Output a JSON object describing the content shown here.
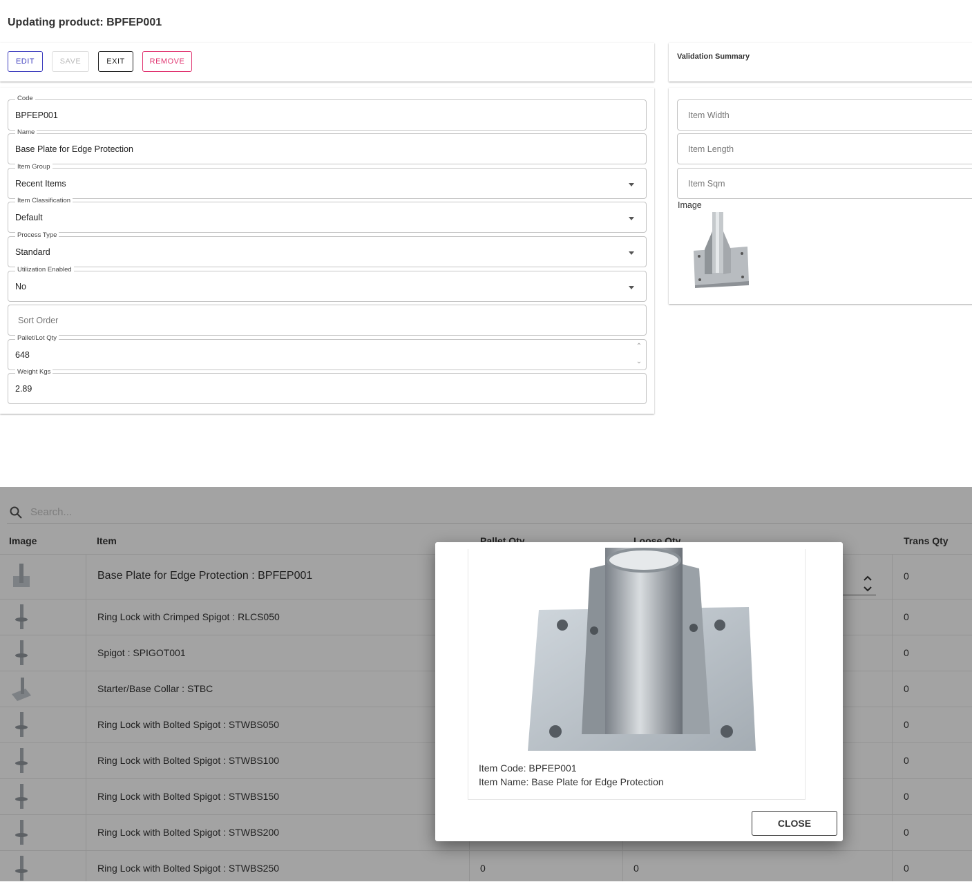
{
  "page": {
    "title": "Updating product: BPFEP001"
  },
  "toolbar": {
    "edit": "EDIT",
    "save": "SAVE",
    "exit": "EXIT",
    "remove": "REMOVE"
  },
  "validation": {
    "title": "Validation Summary"
  },
  "form": {
    "code": {
      "label": "Code",
      "value": "BPFEP001"
    },
    "name": {
      "label": "Name",
      "value": "Base Plate for Edge Protection"
    },
    "item_group": {
      "label": "Item Group",
      "value": "Recent Items"
    },
    "item_classification": {
      "label": "Item Classification",
      "value": "Default"
    },
    "process_type": {
      "label": "Process Type",
      "value": "Standard"
    },
    "utilization_enabled": {
      "label": "Utilization Enabled",
      "value": "No"
    },
    "sort_order": {
      "placeholder": "Sort Order"
    },
    "pallet_lot_qty": {
      "label": "Pallet/Lot Qty",
      "value": "648"
    },
    "weight_kgs": {
      "label": "Weight Kgs",
      "value": "2.89"
    }
  },
  "side": {
    "item_width": "Item Width",
    "item_length": "Item Length",
    "item_sqm": "Item Sqm",
    "image_label": "Image"
  },
  "table": {
    "search_placeholder": "Search...",
    "headers": {
      "image": "Image",
      "item": "Item",
      "pallet_qty": "Pallet Qty",
      "loose_qty": "Loose Qty",
      "trans_qty": "Trans Qty"
    },
    "rows": [
      {
        "item": "Base Plate for Edge Protection : BPFEP001",
        "trans_qty": "0"
      },
      {
        "item": "Ring Lock with Crimped Spigot : RLCS050",
        "trans_qty": "0"
      },
      {
        "item": "Spigot : SPIGOT001",
        "trans_qty": "0"
      },
      {
        "item": "Starter/Base Collar : STBC",
        "trans_qty": "0"
      },
      {
        "item": "Ring Lock with Bolted Spigot : STWBS050",
        "trans_qty": "0"
      },
      {
        "item": "Ring Lock with Bolted Spigot : STWBS100",
        "trans_qty": "0"
      },
      {
        "item": "Ring Lock with Bolted Spigot : STWBS150",
        "trans_qty": "0"
      },
      {
        "item": "Ring Lock with Bolted Spigot : STWBS200",
        "trans_qty": "0"
      },
      {
        "item": "Ring Lock with Bolted Spigot : STWBS250",
        "pallet_qty": "0",
        "loose_qty": "0",
        "trans_qty": "0"
      }
    ]
  },
  "modal": {
    "item_code": "Item Code: BPFEP001",
    "item_name": "Item Name: Base Plate for Edge Protection",
    "close": "CLOSE"
  },
  "colors": {
    "accent": "#3f3fbf",
    "danger": "#e0326f",
    "overlay": "#a3a3a3"
  }
}
